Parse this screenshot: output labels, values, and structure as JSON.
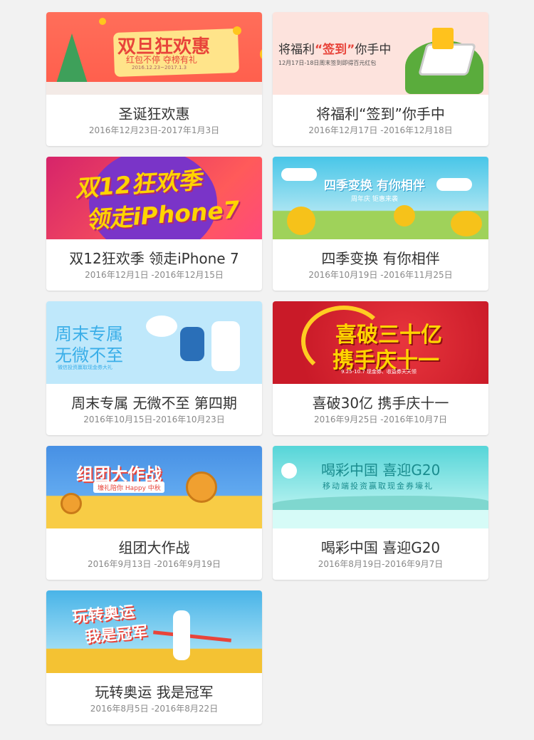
{
  "activities": [
    {
      "title": "圣诞狂欢惠",
      "date": "2016年12月23日-2017年1月3日",
      "banner": {
        "headline": "双旦狂欢惠",
        "sub1": "红包不停  夺榜有礼",
        "sub2": "2016.12.23~2017.1.3"
      }
    },
    {
      "title": "将福利“签到”你手中",
      "date": "2016年12月17日 -2016年12月18日",
      "banner": {
        "headline_a": "将福利",
        "headline_b": "“签到”",
        "headline_c": "你手中",
        "sub": "12月17日-18日周末签到即得百元红包"
      }
    },
    {
      "title": "双12狂欢季 领走iPhone 7",
      "date": "2016年12月1日 -2016年12月15日",
      "banner": {
        "line1": "双12狂欢季",
        "line2": "领走iPhone7"
      }
    },
    {
      "title": "四季变换 有你相伴",
      "date": "2016年10月19日 -2016年11月25日",
      "banner": {
        "headline": "四季变换 有你相伴",
        "sub": "周年庆  钜惠来袭"
      }
    },
    {
      "title": "周末专属 无微不至 第四期",
      "date": "2016年10月15日-2016年10月23日",
      "banner": {
        "line1": "周末专属",
        "line2": "无微不至",
        "sub": "微信投资赢取现金券大礼"
      }
    },
    {
      "title": "喜破30亿 携手庆十一",
      "date": "2016年9月25日 -2016年10月7日",
      "banner": {
        "line1": "喜破三十亿",
        "line2": "携手庆十一",
        "sub": "9.25-10.7 现金券、收益券天天领"
      }
    },
    {
      "title": "组团大作战",
      "date": "2016年9月13日 -2016年9月19日",
      "banner": {
        "headline": "组团大作战",
        "sub": "壕礼陪你 Happy 中秋"
      }
    },
    {
      "title": "喝彩中国 喜迎G20",
      "date": "2016年8月19日-2016年9月7日",
      "banner": {
        "headline": "喝彩中国 喜迎G20",
        "sub": "移动端投资赢取现金券壕礼"
      }
    },
    {
      "title": "玩转奥运 我是冠军",
      "date": "2016年8月5日 -2016年8月22日",
      "banner": {
        "line1": "玩转奥运",
        "line2": "我是冠军"
      }
    }
  ]
}
